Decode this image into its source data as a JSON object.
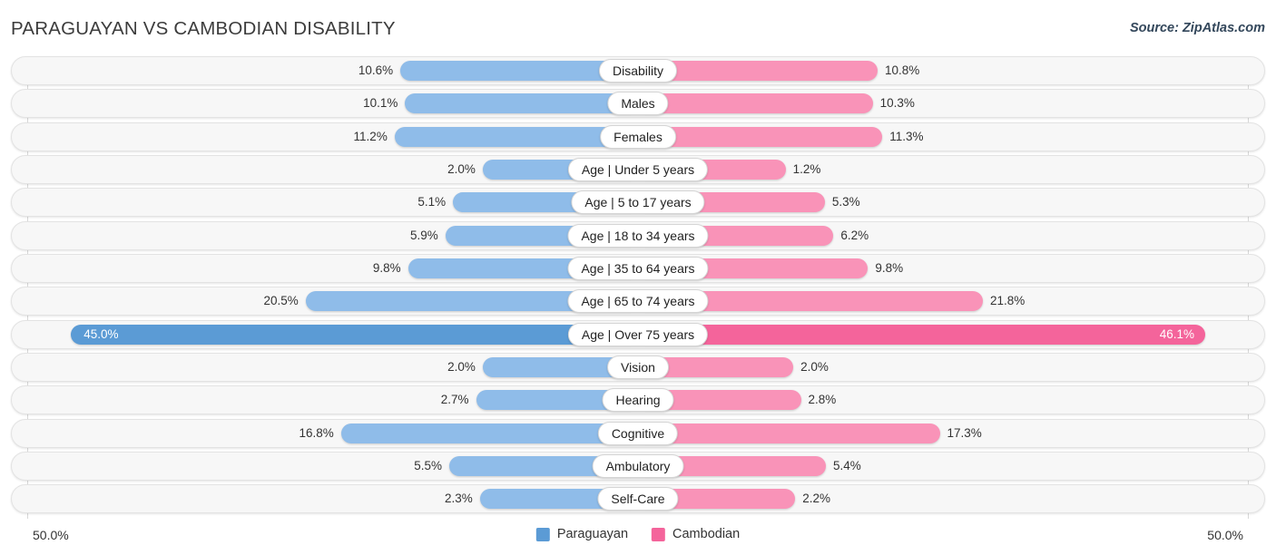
{
  "header": {
    "title": "PARAGUAYAN VS CAMBODIAN DISABILITY",
    "source": "Source: ZipAtlas.com"
  },
  "axis": {
    "left_label": "50.0%",
    "right_label": "50.0%",
    "max": 50.0
  },
  "legend": {
    "items": [
      {
        "label": "Paraguayan",
        "color": "#5b9bd5"
      },
      {
        "label": "Cambodian",
        "color": "#f4649b"
      }
    ]
  },
  "colors": {
    "left_bar": "#8fbce9",
    "right_bar": "#f993b8",
    "left_bar_highlight": "#5b9bd5",
    "right_bar_highlight": "#f4649b",
    "track": "#f7f7f7",
    "gridline": "#d8d8d8"
  },
  "chart_data": {
    "type": "bar",
    "title": "PARAGUAYAN VS CAMBODIAN DISABILITY",
    "subtitle": "Source: ZipAtlas.com",
    "orientation": "horizontal-diverging",
    "xlabel": "",
    "ylabel": "",
    "xlim": [
      50.0,
      50.0
    ],
    "grid": true,
    "legend_position": "bottom-center",
    "categories": [
      "Disability",
      "Males",
      "Females",
      "Age | Under 5 years",
      "Age | 5 to 17 years",
      "Age | 18 to 34 years",
      "Age | 35 to 64 years",
      "Age | 65 to 74 years",
      "Age | Over 75 years",
      "Vision",
      "Hearing",
      "Cognitive",
      "Ambulatory",
      "Self-Care"
    ],
    "series": [
      {
        "name": "Paraguayan",
        "values": [
          10.6,
          10.1,
          11.2,
          2.0,
          5.1,
          5.9,
          9.8,
          20.5,
          45.0,
          2.0,
          2.7,
          16.8,
          5.5,
          2.3
        ]
      },
      {
        "name": "Cambodian",
        "values": [
          10.8,
          10.3,
          11.3,
          1.2,
          5.3,
          6.2,
          9.8,
          21.8,
          46.1,
          2.0,
          2.8,
          17.3,
          5.4,
          2.2
        ]
      }
    ],
    "value_labels": {
      "Paraguayan": [
        "10.6%",
        "10.1%",
        "11.2%",
        "2.0%",
        "5.1%",
        "5.9%",
        "9.8%",
        "20.5%",
        "45.0%",
        "2.0%",
        "2.7%",
        "16.8%",
        "5.5%",
        "2.3%"
      ],
      "Cambodian": [
        "10.8%",
        "10.3%",
        "11.3%",
        "1.2%",
        "5.3%",
        "6.2%",
        "9.8%",
        "21.8%",
        "46.1%",
        "2.0%",
        "2.8%",
        "17.3%",
        "5.4%",
        "2.2%"
      ]
    },
    "highlighted_row": "Age | Over 75 years"
  }
}
